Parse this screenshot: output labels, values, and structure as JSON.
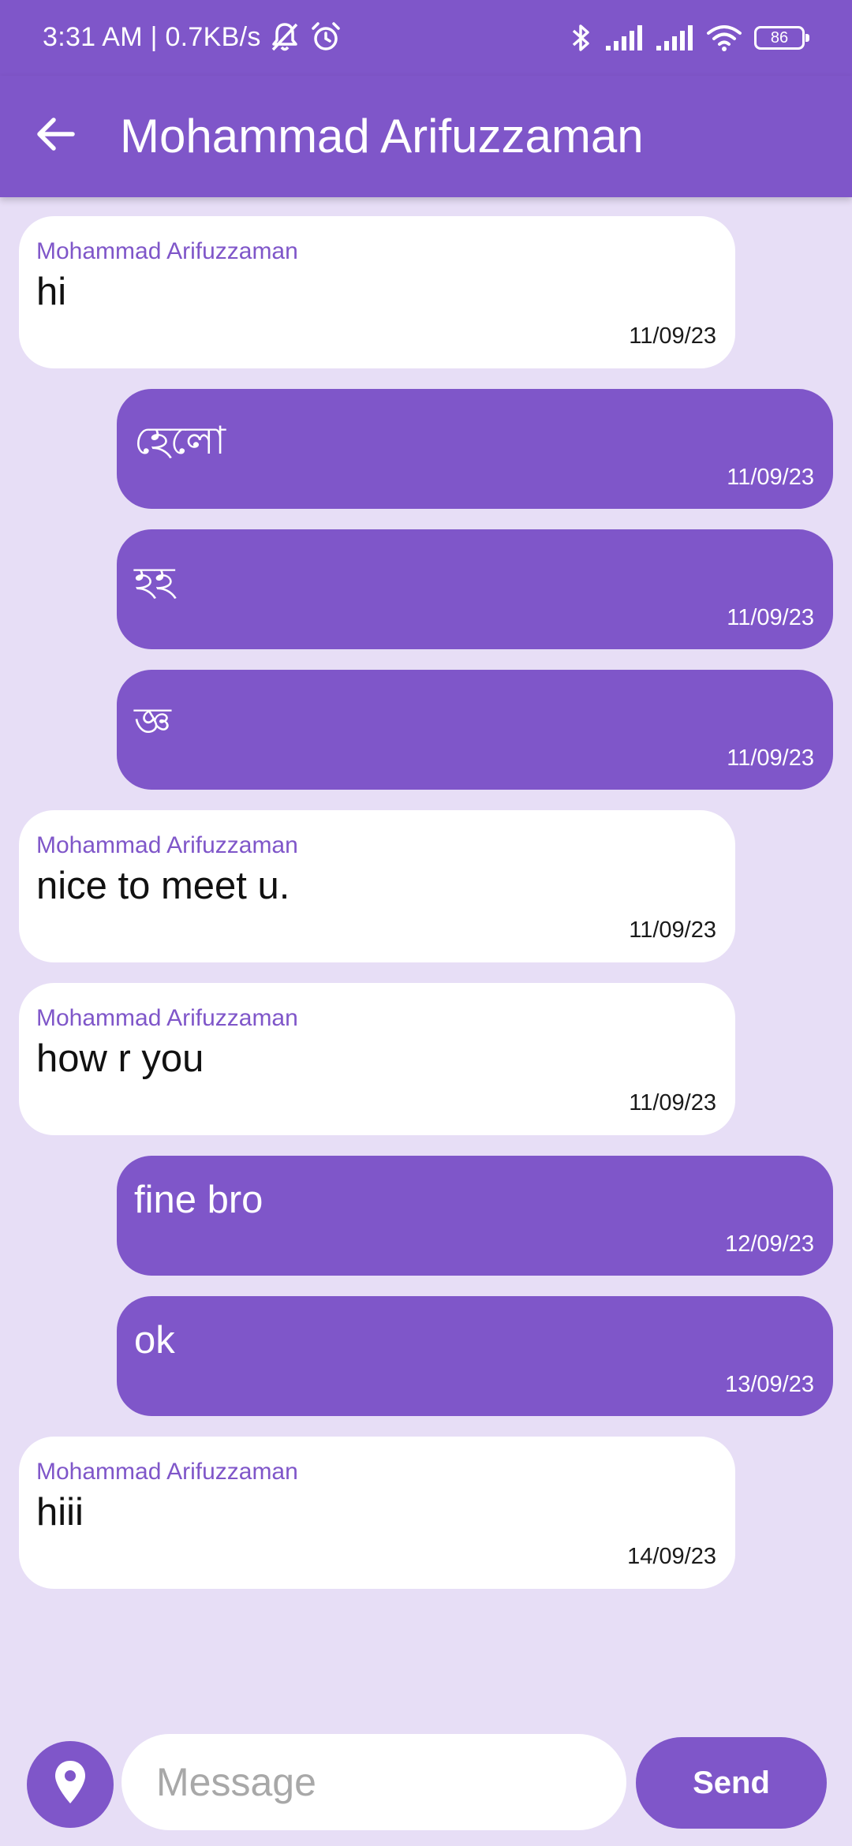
{
  "colors": {
    "primary": "#7f56c9",
    "background": "#e7def6",
    "incoming_bubble": "#ffffff",
    "outgoing_bubble": "#7f56c9",
    "sender_name": "#7f56c9"
  },
  "status_bar": {
    "left_text": "3:31 AM | 0.7KB/s",
    "icons": [
      "notifications-off-icon",
      "alarm-icon",
      "bluetooth-icon",
      "signal-icon",
      "signal-icon",
      "wifi-icon",
      "battery-icon"
    ],
    "battery": "86"
  },
  "app_bar": {
    "back_icon": "arrow-back-icon",
    "title": "Mohammad Arifuzzaman"
  },
  "messages": [
    {
      "direction": "incoming",
      "sender": "Mohammad Arifuzzaman",
      "text": "hi",
      "date": "11/09/23"
    },
    {
      "direction": "outgoing",
      "text": "হেলো",
      "date": "11/09/23"
    },
    {
      "direction": "outgoing",
      "text": "হহ",
      "date": "11/09/23"
    },
    {
      "direction": "outgoing",
      "text": "জ্ঞ",
      "date": "11/09/23"
    },
    {
      "direction": "incoming",
      "sender": "Mohammad Arifuzzaman",
      "text": "nice to meet u.",
      "date": "11/09/23"
    },
    {
      "direction": "incoming",
      "sender": "Mohammad Arifuzzaman",
      "text": "how r you",
      "date": "11/09/23"
    },
    {
      "direction": "outgoing",
      "text": "fine bro",
      "date": "12/09/23"
    },
    {
      "direction": "outgoing",
      "text": "ok",
      "date": "13/09/23"
    },
    {
      "direction": "incoming",
      "sender": "Mohammad Arifuzzaman",
      "text": "hiii",
      "date": "14/09/23"
    }
  ],
  "composer": {
    "location_icon": "location-pin-icon",
    "placeholder": "Message",
    "value": "",
    "send_label": "Send"
  }
}
